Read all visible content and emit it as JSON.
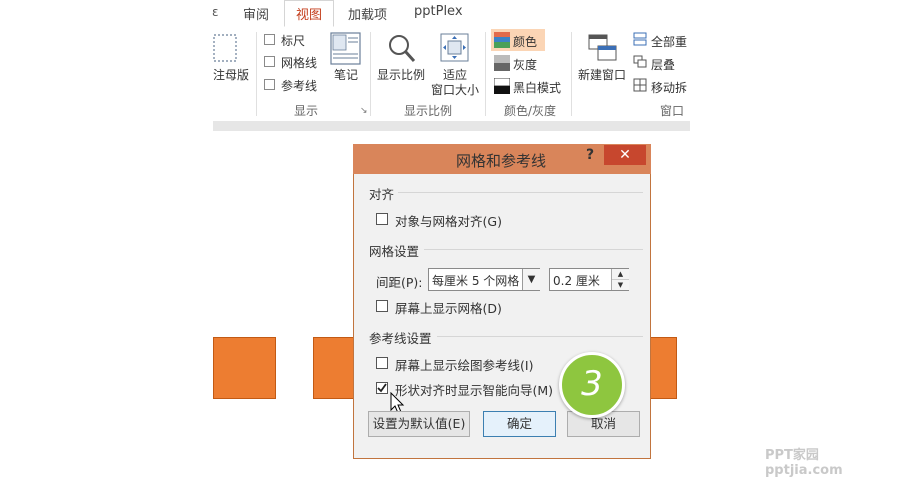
{
  "ribbon": {
    "tabs": [
      "审阅",
      "视图",
      "加载项",
      "pptPlex"
    ],
    "active_tab": "视图",
    "partial_tab": "ɛ",
    "master_label": "注母版",
    "show_group": {
      "items": [
        "标尺",
        "网格线",
        "参考线"
      ],
      "notes_label": "笔记",
      "label": "显示"
    },
    "zoom_group": {
      "zoom_label": "显示比例",
      "fit_label_1": "适应",
      "fit_label_2": "窗口大小",
      "label": "显示比例"
    },
    "color_group": {
      "items": [
        "颜色",
        "灰度",
        "黑白模式"
      ],
      "label": "颜色/灰度"
    },
    "window_group": {
      "new_window_label": "新建窗口",
      "items": [
        "全部重",
        "层叠",
        "移动拆"
      ],
      "label": "窗口"
    }
  },
  "dialog": {
    "title": "网格和参考线",
    "help": "?",
    "close": "✕",
    "align_section": "对齐",
    "snap_to_grid": "对象与网格对齐(G)",
    "grid_section": "网格设置",
    "spacing_label": "间距(P):",
    "spacing_select": "每厘米 5 个网格",
    "spacing_value": "0.2 厘米",
    "show_grid": "屏幕上显示网格(D)",
    "guides_section": "参考线设置",
    "show_guides": "屏幕上显示绘图参考线(I)",
    "smart_guides": "形状对齐时显示智能向导(M)",
    "smart_guides_checked": true,
    "set_default_button": "设置为默认值(E)",
    "ok_button": "确定",
    "cancel_button": "取消"
  },
  "step_badge": "3",
  "watermark": "PPT家园 pptjia.com",
  "colors": {
    "accent": "#d9855a",
    "shape": "#ed7d31",
    "badge": "#8ec63f",
    "close": "#c7472e"
  }
}
